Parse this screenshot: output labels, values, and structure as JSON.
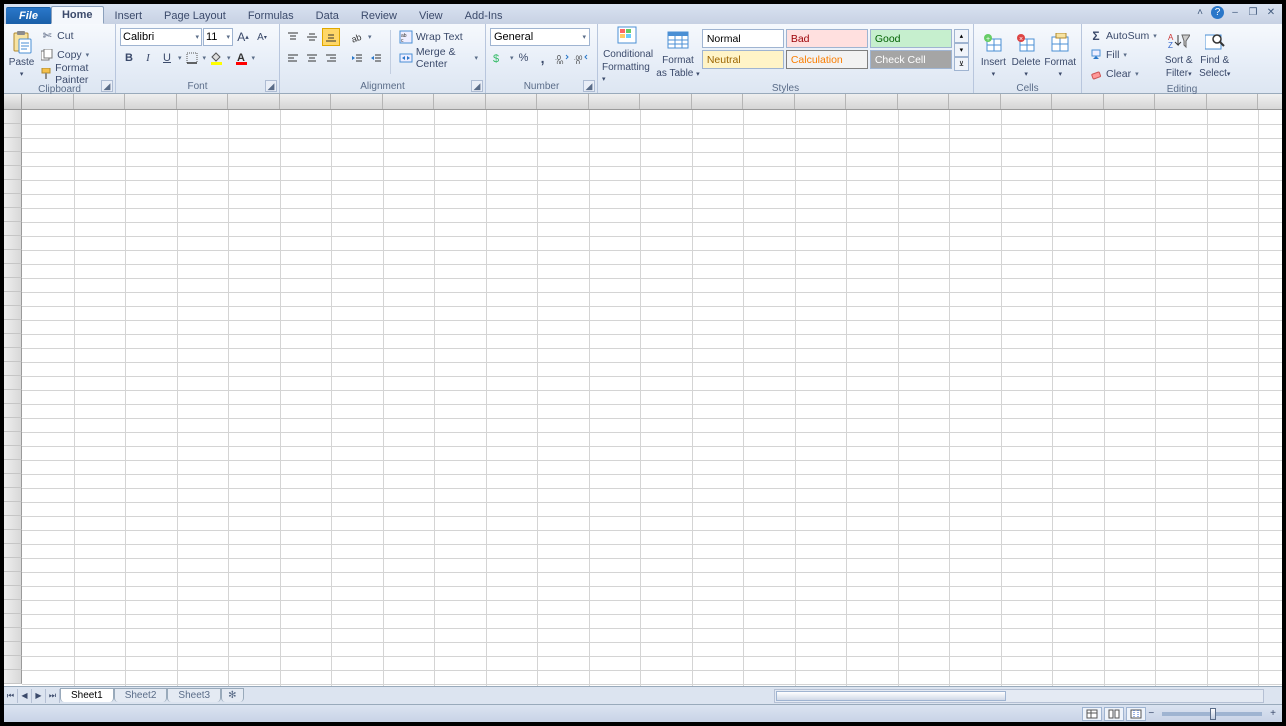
{
  "tabs": {
    "file": "File",
    "items": [
      "Home",
      "Insert",
      "Page Layout",
      "Formulas",
      "Data",
      "Review",
      "View",
      "Add-Ins"
    ],
    "active": "Home"
  },
  "clipboard": {
    "paste": "Paste",
    "cut": "Cut",
    "copy": "Copy",
    "format_painter": "Format Painter",
    "label": "Clipboard"
  },
  "font": {
    "name": "Calibri",
    "size": "11",
    "label": "Font"
  },
  "alignment": {
    "wrap": "Wrap Text",
    "merge": "Merge & Center",
    "label": "Alignment"
  },
  "number": {
    "format": "General",
    "label": "Number"
  },
  "styles": {
    "cond": "Conditional Formatting",
    "cond1": "Conditional",
    "cond2": "Formatting",
    "fmt1": "Format",
    "fmt2": "as Table",
    "normal": "Normal",
    "bad": "Bad",
    "good": "Good",
    "neutral": "Neutral",
    "calculation": "Calculation",
    "checkcell": "Check Cell",
    "label": "Styles"
  },
  "cells": {
    "insert": "Insert",
    "delete": "Delete",
    "format": "Format",
    "label": "Cells"
  },
  "editing": {
    "autosum": "AutoSum",
    "fill": "Fill",
    "clear": "Clear",
    "sort1": "Sort &",
    "sort2": "Filter",
    "find1": "Find &",
    "find2": "Select",
    "label": "Editing"
  },
  "sheets": [
    "Sheet1",
    "Sheet2",
    "Sheet3"
  ]
}
